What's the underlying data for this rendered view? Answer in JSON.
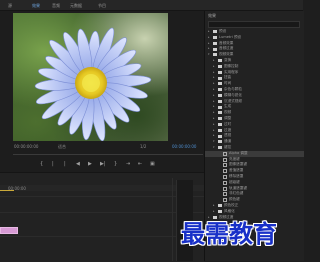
{
  "topbar": {
    "tabs": [
      "源",
      "效果",
      "音频",
      "元数据"
    ],
    "right_tab": "节目"
  },
  "monitor": {
    "fit_label": "适合",
    "timecode_left": "00:00:00:00",
    "timecode_right": "00:00:00:00",
    "page_label": "1/2"
  },
  "transport": [
    "{",
    "|",
    "|",
    "◀",
    "▶",
    "▶|",
    "}",
    "⇥",
    "⇤",
    "▣"
  ],
  "timeline": {
    "ruler_label": "00:00:00"
  },
  "effects_panel": {
    "title": "效果",
    "rows": [
      {
        "text": "预设",
        "level": 0,
        "type": "folder"
      },
      {
        "text": "Lumetri 预设",
        "level": 0,
        "type": "folder"
      },
      {
        "text": "音频效果",
        "level": 0,
        "type": "folder"
      },
      {
        "text": "音频过渡",
        "level": 0,
        "type": "folder"
      },
      {
        "text": "视频效果",
        "level": 0,
        "type": "folder",
        "open": true
      },
      {
        "text": "变换",
        "level": 1,
        "type": "folder"
      },
      {
        "text": "图像控制",
        "level": 1,
        "type": "folder"
      },
      {
        "text": "实用程序",
        "level": 1,
        "type": "folder"
      },
      {
        "text": "扭曲",
        "level": 1,
        "type": "folder"
      },
      {
        "text": "时间",
        "level": 1,
        "type": "folder"
      },
      {
        "text": "杂色与颗粒",
        "level": 1,
        "type": "folder"
      },
      {
        "text": "模糊与锐化",
        "level": 1,
        "type": "folder"
      },
      {
        "text": "沉浸式视频",
        "level": 1,
        "type": "folder"
      },
      {
        "text": "生成",
        "level": 1,
        "type": "folder"
      },
      {
        "text": "视频",
        "level": 1,
        "type": "folder"
      },
      {
        "text": "调整",
        "level": 1,
        "type": "folder"
      },
      {
        "text": "过时",
        "level": 1,
        "type": "folder"
      },
      {
        "text": "过渡",
        "level": 1,
        "type": "folder"
      },
      {
        "text": "透视",
        "level": 1,
        "type": "folder"
      },
      {
        "text": "通道",
        "level": 1,
        "type": "folder",
        "open": true
      },
      {
        "text": "键控",
        "level": 1,
        "type": "folder",
        "open": true
      },
      {
        "text": "Alpha 调整",
        "level": 2,
        "type": "fx",
        "selected": true
      },
      {
        "text": "亮度键",
        "level": 2,
        "type": "fx"
      },
      {
        "text": "图像遮罩键",
        "level": 2,
        "type": "fx"
      },
      {
        "text": "差值遮罩",
        "level": 2,
        "type": "fx"
      },
      {
        "text": "移除遮罩",
        "level": 2,
        "type": "fx"
      },
      {
        "text": "超级键",
        "level": 2,
        "type": "fx"
      },
      {
        "text": "轨道遮罩键",
        "level": 2,
        "type": "fx"
      },
      {
        "text": "非红色键",
        "level": 2,
        "type": "fx"
      },
      {
        "text": "颜色键",
        "level": 2,
        "type": "fx"
      },
      {
        "text": "颜色校正",
        "level": 1,
        "type": "folder"
      },
      {
        "text": "风格化",
        "level": 1,
        "type": "folder"
      },
      {
        "text": "视频过渡",
        "level": 0,
        "type": "folder"
      }
    ]
  },
  "watermark": "最需教育"
}
